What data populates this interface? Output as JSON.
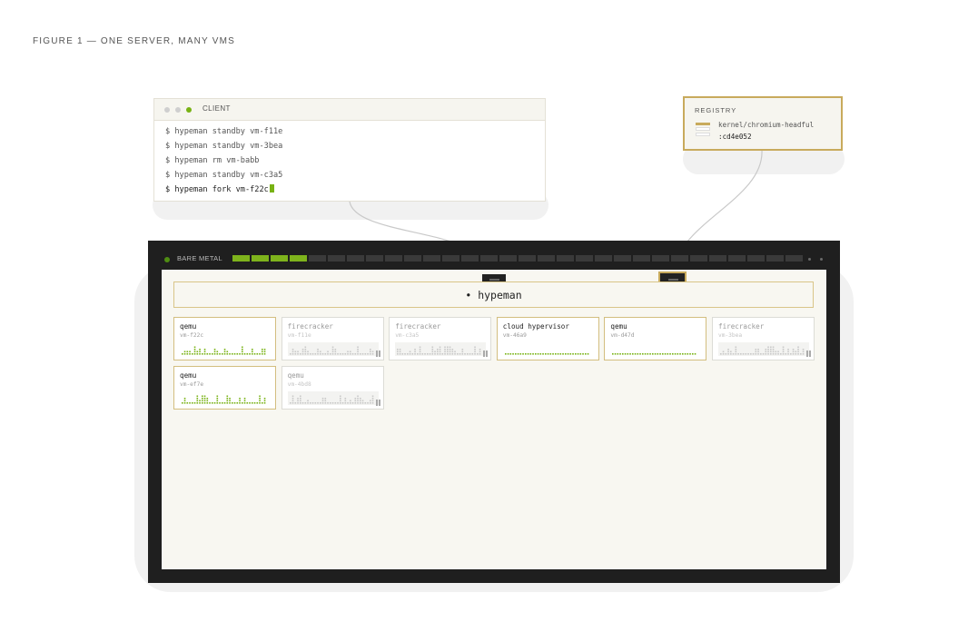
{
  "figure_title": "FIGURE 1 — ONE SERVER, MANY VMS",
  "colors": {
    "accent_green": "#78b214",
    "accent_gold": "#c8aa5c",
    "server_dark": "#1f1f1f",
    "panel_cream": "#f8f7f1"
  },
  "client": {
    "title": "CLIENT",
    "lines": [
      {
        "text": "$ hypeman standby vm-f11e",
        "active": false
      },
      {
        "text": "$ hypeman standby vm-3bea",
        "active": false
      },
      {
        "text": "$ hypeman rm vm-babb",
        "active": false
      },
      {
        "text": "$ hypeman standby vm-c3a5",
        "active": false
      },
      {
        "text": "$ hypeman fork vm-f22c",
        "active": true
      }
    ]
  },
  "registry": {
    "title": "REGISTRY",
    "image": "kernel/chromium-headful",
    "tag": ":cd4e052"
  },
  "server": {
    "label": "BARE METAL",
    "cores_total": 30,
    "cores_active": 4
  },
  "hypeman": {
    "label": "• hypeman"
  },
  "vms": [
    {
      "hypervisor": "qemu",
      "id": "vm-f22c",
      "state": "running"
    },
    {
      "hypervisor": "firecracker",
      "id": "vm-f11e",
      "state": "standby"
    },
    {
      "hypervisor": "firecracker",
      "id": "vm-c3a5",
      "state": "standby"
    },
    {
      "hypervisor": "cloud hypervisor",
      "id": "vm-46a9",
      "state": "running"
    },
    {
      "hypervisor": "qemu",
      "id": "vm-d47d",
      "state": "running"
    },
    {
      "hypervisor": "firecracker",
      "id": "vm-3bea",
      "state": "standby"
    },
    {
      "hypervisor": "qemu",
      "id": "vm-ef7e",
      "state": "running"
    },
    {
      "hypervisor": "qemu",
      "id": "vm-4bd8",
      "state": "standby"
    }
  ]
}
